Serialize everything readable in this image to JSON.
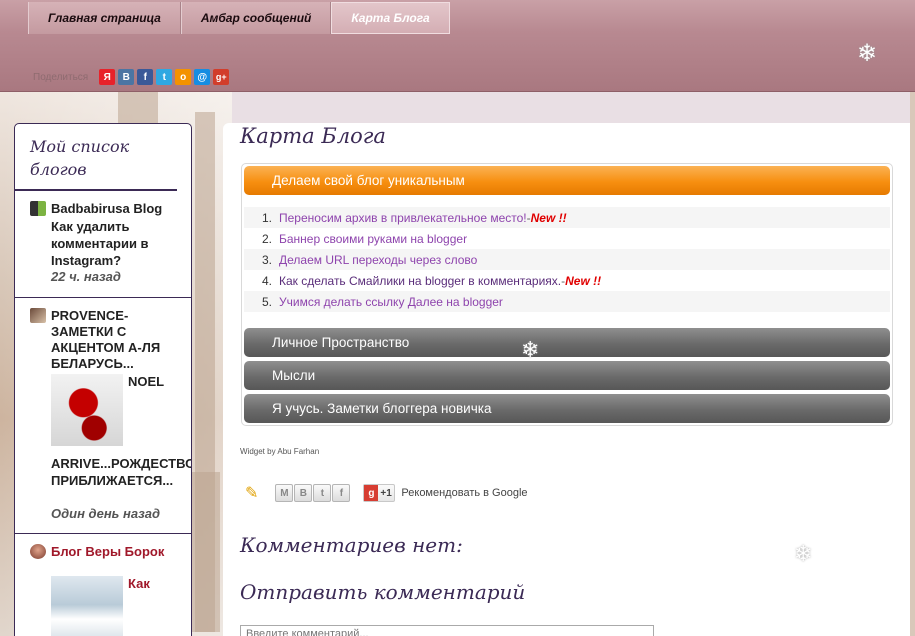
{
  "nav": {
    "tabs": [
      {
        "label": "Главная страница"
      },
      {
        "label": "Амбар сообщений"
      },
      {
        "label": "Карта Блога"
      }
    ]
  },
  "share": {
    "label": "Поделиться",
    "buttons": [
      {
        "icon": "yandex-icon",
        "glyph": "Я",
        "color": "#e8222a"
      },
      {
        "icon": "vkontakte-icon",
        "glyph": "B",
        "color": "#4c75a3"
      },
      {
        "icon": "facebook-icon",
        "glyph": "f",
        "color": "#3b5998"
      },
      {
        "icon": "twitter-icon",
        "glyph": "t",
        "color": "#2fa8e2"
      },
      {
        "icon": "odnoklassniki-icon",
        "glyph": "о",
        "color": "#f39200"
      },
      {
        "icon": "mailru-icon",
        "glyph": "@",
        "color": "#168de2"
      },
      {
        "icon": "google-plus-icon",
        "glyph": "g+",
        "color": "#d23d2b"
      }
    ]
  },
  "sidebar": {
    "title": "Мой список блогов",
    "blogs": [
      {
        "name": "Badbabirusa Blog",
        "post": "Как удалить комментарии в Instagram?",
        "age": "22 ч. назад"
      },
      {
        "name": "PROVENCE-ЗАМЕТКИ С АКЦЕНТОМ А-ЛЯ БЕЛАРУСЬ...",
        "post_side": "NOEL",
        "post": "ARRIVE...РОЖДЕСТВО ПРИБЛИЖАЕТСЯ...",
        "age": "Один день назад"
      },
      {
        "name": "Блог Веры Борок",
        "post_side": "Как"
      }
    ]
  },
  "main": {
    "title": "Карта Блога",
    "sections": [
      {
        "label": "Делаем свой блог уникальным",
        "items": [
          {
            "num": "1.",
            "text": "Переносим архив в привлекательное место!",
            "sep": " - ",
            "new": "New !!"
          },
          {
            "num": "2.",
            "text": "Баннер своими руками на blogger"
          },
          {
            "num": "3.",
            "text": "Делаем URL переходы через слово"
          },
          {
            "num": "4.",
            "text": "Как сделать Смайлики на blogger в комментариях.",
            "sep": " - ",
            "new": "New !!"
          },
          {
            "num": "5.",
            "text": "Учимся делать ссылку Далее на blogger"
          }
        ]
      },
      {
        "label": "Личное Пространство"
      },
      {
        "label": "Мысли"
      },
      {
        "label": "Я учусь. Заметки блоггера новичка"
      }
    ],
    "widget_credit": "Widget by Abu Farhan",
    "share_buttons": [
      {
        "icon": "gmail-icon",
        "glyph": "M"
      },
      {
        "icon": "blogger-icon",
        "glyph": "B"
      },
      {
        "icon": "twitter-icon",
        "glyph": "t"
      },
      {
        "icon": "facebook-icon",
        "glyph": "f"
      }
    ],
    "gplus": {
      "g": "g",
      "plus": "+1"
    },
    "recommend": "Рекомендовать в Google",
    "comments_heading": "Комментариев нет:",
    "post_comment_heading": "Отправить комментарий",
    "comment_placeholder": "Введите комментарий..."
  },
  "colors": {
    "accent": "#3b2a55",
    "link": "#8e44ad",
    "new": "#e00000",
    "orange": "#f78f10"
  }
}
